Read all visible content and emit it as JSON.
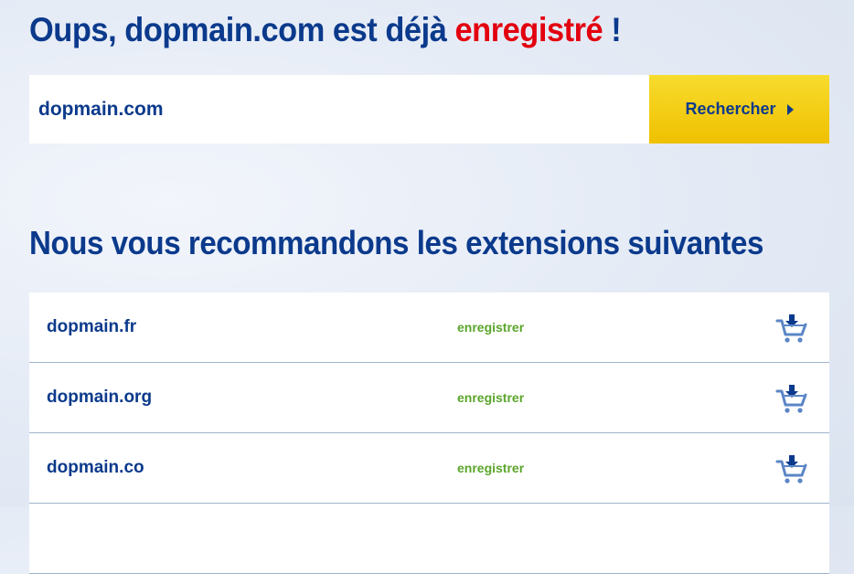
{
  "header": {
    "title_prefix": "Oups, dopmain.com est déjà",
    "title_highlight": "enregistré",
    "title_suffix": " !"
  },
  "search": {
    "value": "dopmain.com",
    "button_label": "Rechercher"
  },
  "recommendations": {
    "heading": "Nous vous recommandons les extensions suivantes",
    "rows": [
      {
        "domain": "dopmain.fr",
        "action": "enregistrer",
        "icon": "add-to-cart-icon"
      },
      {
        "domain": "dopmain.org",
        "action": "enregistrer",
        "icon": "add-to-cart-icon"
      },
      {
        "domain": "dopmain.co",
        "action": "enregistrer",
        "icon": "add-to-cart-icon"
      }
    ]
  },
  "colors": {
    "brand_blue": "#0b3a8c",
    "highlight_red": "#e3000f",
    "action_green": "#5aa52a",
    "button_yellow": "#f0c000",
    "cart_blue": "#5b86c6"
  }
}
